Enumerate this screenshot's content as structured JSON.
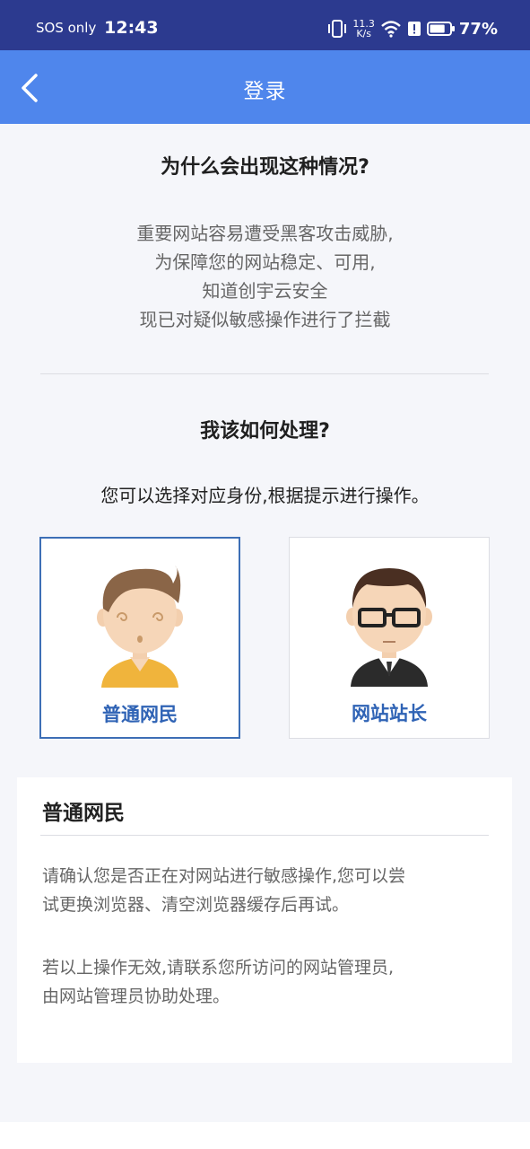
{
  "status_bar": {
    "carrier": "SOS only",
    "time": "12:43",
    "speed_value": "11.3",
    "speed_unit": "K/s",
    "battery_percent": "77%",
    "battery_level": 0.77,
    "icons": [
      "vibrate-icon",
      "wifi-icon",
      "alert-icon",
      "battery-icon"
    ]
  },
  "navbar": {
    "title": "登录",
    "back_icon": "chevron-left-icon"
  },
  "why": {
    "heading": "为什么会出现这种情况?",
    "lines": [
      "重要网站容易遭受黑客攻击威胁,",
      "为保障您的网站稳定、可用,",
      "知道创宇云安全",
      "现已对疑似敏感操作进行了拦截"
    ]
  },
  "how": {
    "heading": "我该如何处理?",
    "subtitle": "您可以选择对应身份,根据提示进行操作。"
  },
  "roles": [
    {
      "label": "普通网民",
      "selected": true,
      "avatar": "confused-user-avatar"
    },
    {
      "label": "网站站长",
      "selected": false,
      "avatar": "webmaster-avatar"
    }
  ],
  "info": {
    "title": "普通网民",
    "paragraph1": [
      "请确认您是否正在对网站进行敏感操作,您可以尝",
      "试更换浏览器、清空浏览器缓存后再试。"
    ],
    "paragraph2": [
      "若以上操作无效,请联系您所访问的网站管理员,",
      "由网站管理员协助处理。"
    ]
  },
  "colors": {
    "status_bar_bg": "#2c3a8f",
    "navbar_bg": "#4f86ec",
    "accent_text": "#2f63b5",
    "selected_border": "#3d6fb6"
  }
}
